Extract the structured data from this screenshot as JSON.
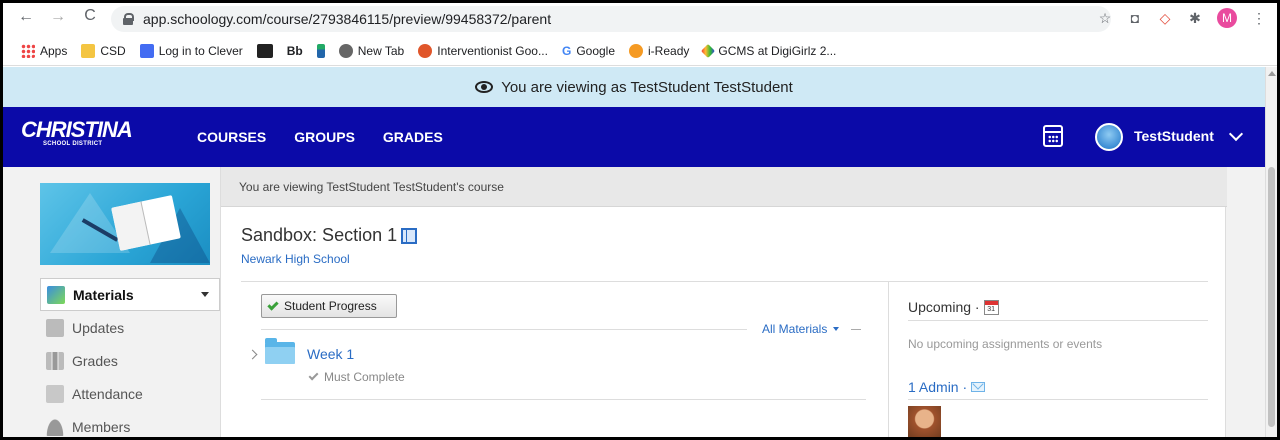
{
  "browser": {
    "url": "app.schoology.com/course/2793846115/preview/99458372/parent",
    "profile_initial": "M",
    "bookmarks": [
      {
        "label": "Apps",
        "icon": "apps-grid-icon"
      },
      {
        "label": "CSD",
        "icon": "folder-icon"
      },
      {
        "label": "Log in to Clever",
        "icon": "clever-icon"
      },
      {
        "label": "",
        "icon": "bookmark-icon"
      },
      {
        "label": "Bb",
        "icon": "blackboard-icon"
      },
      {
        "label": "",
        "icon": "bookmark-icon"
      },
      {
        "label": "New Tab",
        "icon": "globe-icon"
      },
      {
        "label": "Interventionist Goo...",
        "icon": "bookmark-icon"
      },
      {
        "label": "Google",
        "icon": "google-icon"
      },
      {
        "label": "i-Ready",
        "icon": "iready-icon"
      },
      {
        "label": "GCMS at DigiGirlz 2...",
        "icon": "bookmark-icon"
      }
    ]
  },
  "banner": {
    "text": "You are viewing as TestStudent TestStudent"
  },
  "nav": {
    "logo_main": "CHRISTINA",
    "logo_sub": "SCHOOL DISTRICT",
    "links": [
      "COURSES",
      "GROUPS",
      "GRADES"
    ],
    "user_name": "TestStudent"
  },
  "sidebar": {
    "items": [
      {
        "label": "Materials",
        "active": true
      },
      {
        "label": "Updates"
      },
      {
        "label": "Grades"
      },
      {
        "label": "Attendance"
      },
      {
        "label": "Members"
      }
    ]
  },
  "main": {
    "viewing_strip": "You are viewing TestStudent TestStudent's course",
    "course_title": "Sandbox: Section 1",
    "school": "Newark High School",
    "student_progress_label": "Student Progress",
    "all_materials_label": "All Materials",
    "folders": [
      {
        "title": "Week 1",
        "status": "Must Complete"
      }
    ]
  },
  "right": {
    "upcoming_title": "Upcoming ·",
    "calendar_day": "31",
    "no_upcoming": "No upcoming assignments or events",
    "admin_title": "1 Admin ·"
  },
  "colors": {
    "nav_bg": "#0b0aa8",
    "banner_bg": "#cfe9f5",
    "link": "#2a6cc4"
  }
}
